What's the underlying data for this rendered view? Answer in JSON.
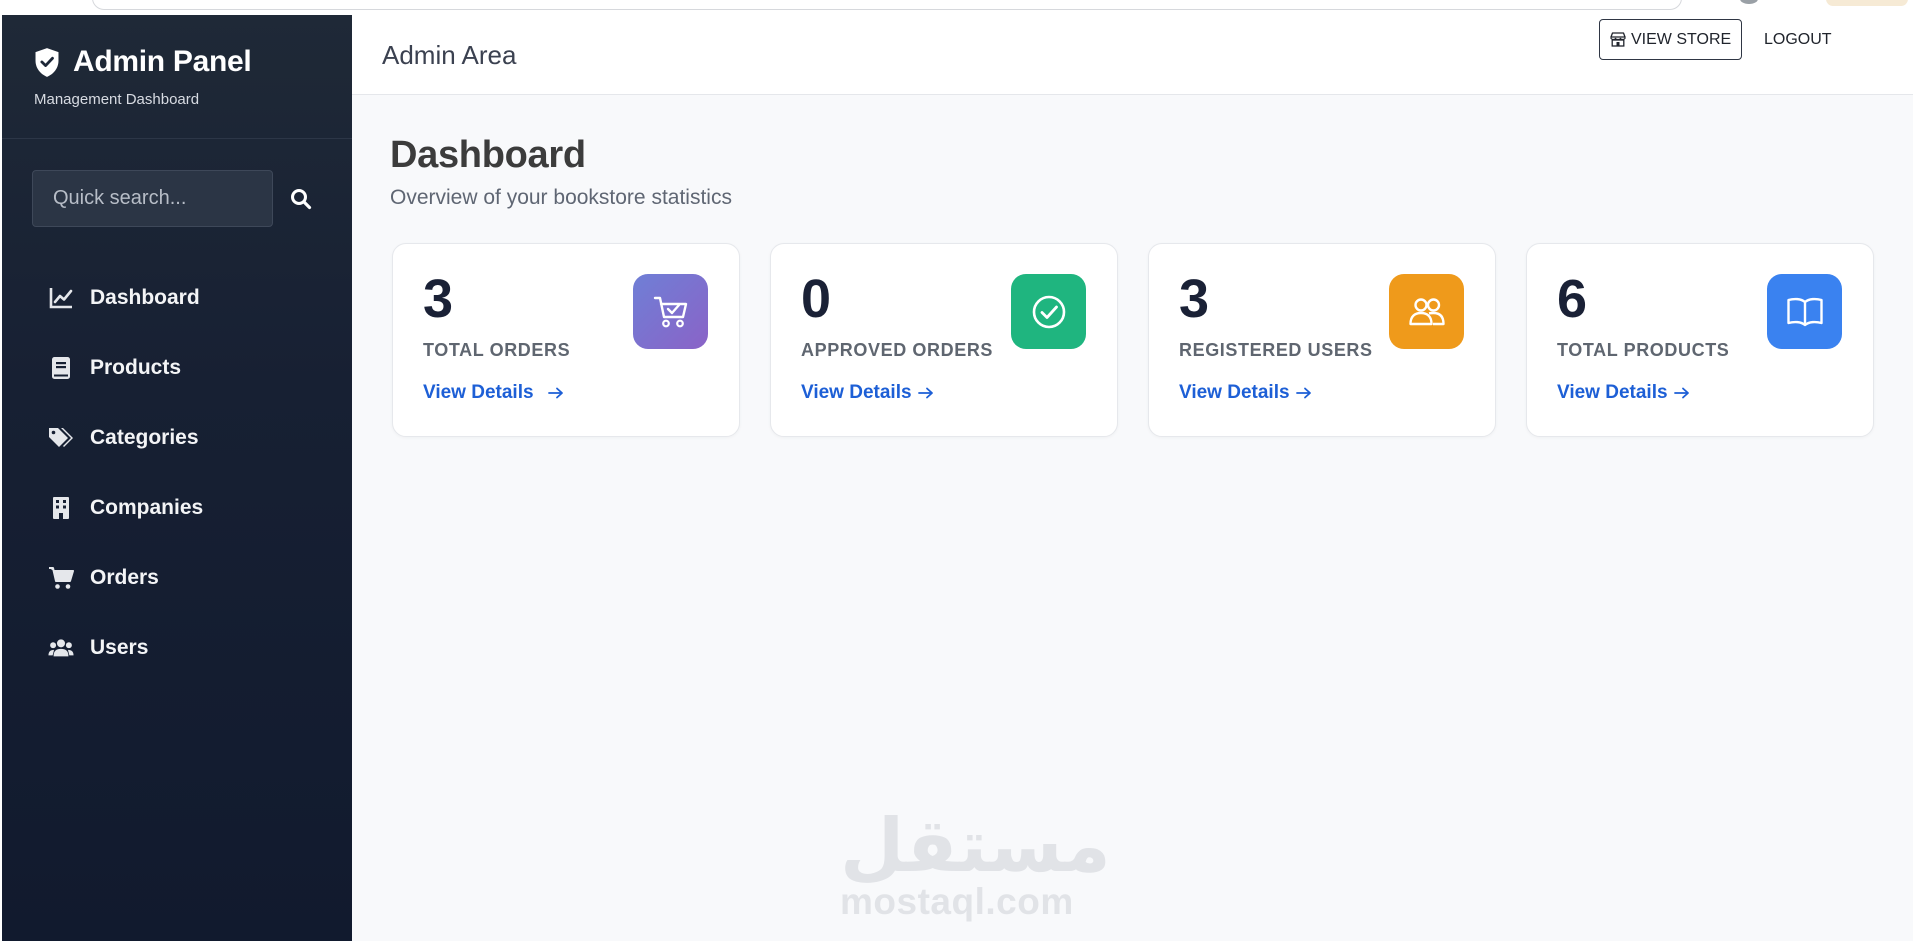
{
  "brand": {
    "title": "Admin Panel",
    "subtitle": "Management Dashboard"
  },
  "search": {
    "placeholder": "Quick search..."
  },
  "sidebar": {
    "items": [
      {
        "label": "Dashboard",
        "icon": "chart-line-icon"
      },
      {
        "label": "Products",
        "icon": "book-icon"
      },
      {
        "label": "Categories",
        "icon": "tags-icon"
      },
      {
        "label": "Companies",
        "icon": "building-icon"
      },
      {
        "label": "Orders",
        "icon": "cart-icon"
      },
      {
        "label": "Users",
        "icon": "users-icon"
      }
    ]
  },
  "header": {
    "title": "Admin Area",
    "view_store_label": "VIEW STORE",
    "logout_label": "LOGOUT"
  },
  "page": {
    "title": "Dashboard",
    "subtitle": "Overview of your bookstore statistics"
  },
  "cards": [
    {
      "value": "3",
      "label": "TOTAL ORDERS",
      "link": "View Details",
      "icon": "shopping-cart-icon",
      "color": "#7e6fd0"
    },
    {
      "value": "0",
      "label": "APPROVED ORDERS",
      "link": "View Details",
      "icon": "check-circle-icon",
      "color": "#1fb57f"
    },
    {
      "value": "3",
      "label": "REGISTERED USERS",
      "link": "View Details",
      "icon": "users-icon",
      "color": "#ef9a1b"
    },
    {
      "value": "6",
      "label": "TOTAL PRODUCTS",
      "link": "View Details",
      "icon": "open-book-icon",
      "color": "#3a82f0"
    }
  ],
  "watermark": {
    "arabic": "مستقل",
    "latin": "mostaql.com"
  },
  "colors": {
    "sidebar_bg": "#1a2336",
    "accent_link": "#1d5fd6",
    "page_bg": "#f8f9fb"
  }
}
